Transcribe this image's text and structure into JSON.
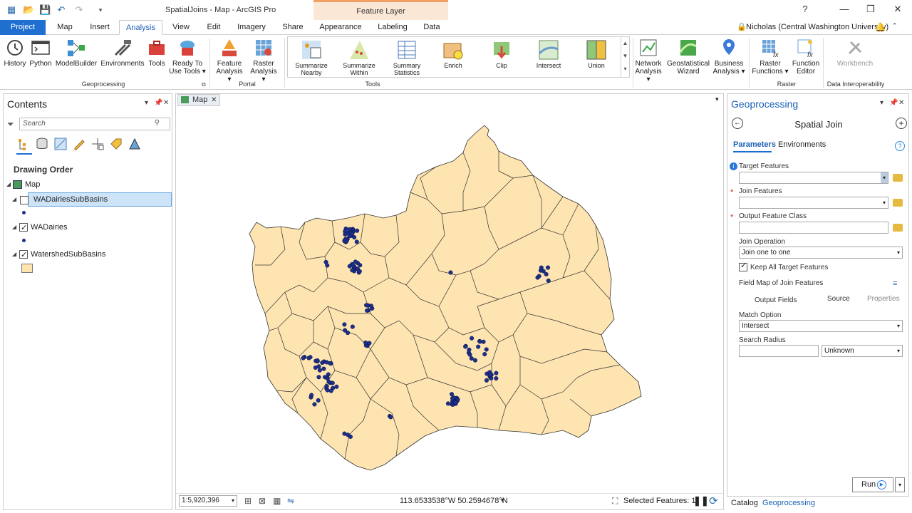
{
  "window": {
    "title": "SpatialJoins - Map - ArcGIS Pro",
    "contextual_group": "Feature Layer",
    "help": "?"
  },
  "tabs": [
    "Project",
    "Map",
    "Insert",
    "Analysis",
    "View",
    "Edit",
    "Imagery",
    "Share",
    "Appearance",
    "Labeling",
    "Data"
  ],
  "active_tab": "Analysis",
  "user": "Nicholas (Central Washington University)",
  "ribbon": {
    "geoprocessing": {
      "label": "Geoprocessing",
      "buttons": [
        "History",
        "Python",
        "ModelBuilder",
        "Environments",
        "Tools",
        "Ready To Use Tools"
      ]
    },
    "portal": {
      "label": "Portal",
      "buttons": [
        "Feature Analysis",
        "Raster Analysis"
      ]
    },
    "tools": {
      "label": "Tools",
      "buttons": [
        "Summarize Nearby",
        "Summarize Within",
        "Summary Statistics",
        "Enrich",
        "Clip",
        "Intersect",
        "Union"
      ]
    },
    "extra": {
      "buttons": [
        "Network Analysis",
        "Geostatistical Wizard",
        "Business Analysis"
      ]
    },
    "raster": {
      "label": "Raster",
      "buttons": [
        "Raster Functions",
        "Function Editor"
      ]
    },
    "interop": {
      "label": "Data Interoperability",
      "buttons": [
        "Workbench"
      ]
    }
  },
  "contents": {
    "title": "Contents",
    "search_placeholder": "Search",
    "drawing_order": "Drawing Order",
    "map_label": "Map",
    "layers": [
      {
        "name": "WADairiesSubBasins",
        "checked": false,
        "selected": true
      },
      {
        "name": "WADairies",
        "checked": true,
        "selected": false
      },
      {
        "name": "WatershedSubBasins",
        "checked": true,
        "selected": false
      }
    ]
  },
  "map": {
    "tab": "Map",
    "scale": "1:5,920,396",
    "coords": "113.6533538°W 50.2594678°N",
    "selected_features": "Selected Features: 1",
    "fill_color": "#fde4b1",
    "dot_color": "#1c2f8a"
  },
  "geoprocessing": {
    "pane_title": "Geoprocessing",
    "tool_title": "Spatial Join",
    "tabs": [
      "Parameters",
      "Environments"
    ],
    "params": {
      "target_features": "Target Features",
      "join_features": "Join Features",
      "output_feature_class": "Output Feature Class",
      "join_operation": "Join Operation",
      "join_operation_value": "Join one to one",
      "keep_all": "Keep All Target Features",
      "field_map": "Field Map of Join Features",
      "field_map_cols": [
        "Output Fields",
        "Source",
        "Properties"
      ],
      "match_option": "Match Option",
      "match_option_value": "Intersect",
      "search_radius": "Search Radius",
      "search_radius_units": "Unknown"
    },
    "run": "Run",
    "bottom_tabs": [
      "Catalog",
      "Geoprocessing"
    ]
  }
}
